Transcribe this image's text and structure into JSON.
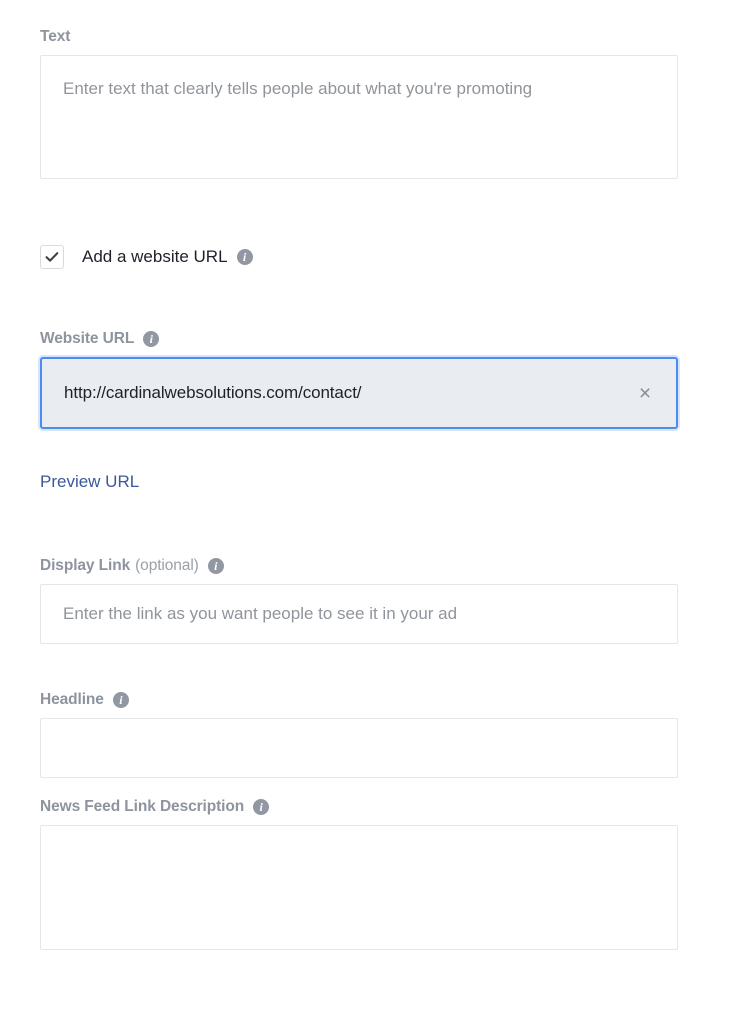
{
  "form": {
    "text_field": {
      "label": "Text",
      "placeholder": "Enter text that clearly tells people about what you're promoting",
      "value": ""
    },
    "website_url_checkbox": {
      "label": "Add a website URL",
      "checked": true,
      "check_glyph": "✓",
      "info_icon": "info-icon",
      "info_glyph": "i"
    },
    "website_url": {
      "label": "Website URL",
      "value": "http://cardinalwebsolutions.com/contact/",
      "clear_glyph": "×",
      "info_glyph": "i",
      "focused": true
    },
    "preview_url_link": {
      "label": "Preview URL"
    },
    "display_link": {
      "label": "Display Link",
      "optional_suffix": "(optional)",
      "placeholder": "Enter the link as you want people to see it in your ad",
      "value": "",
      "info_glyph": "i"
    },
    "headline": {
      "label": "Headline",
      "placeholder": "",
      "value": "",
      "info_glyph": "i"
    },
    "news_feed_link_description": {
      "label": "News Feed Link Description",
      "placeholder": "",
      "value": "",
      "info_glyph": "i"
    }
  },
  "colors": {
    "label_gray": "#8d949e",
    "link_blue": "#3b5998",
    "focus_blue": "#4a8cef",
    "focus_bg": "#e9edf2",
    "border_gray": "#e4e6e9",
    "placeholder_gray": "#90949c",
    "info_icon_gray": "#9197a3",
    "text_dark": "#1d2129"
  }
}
